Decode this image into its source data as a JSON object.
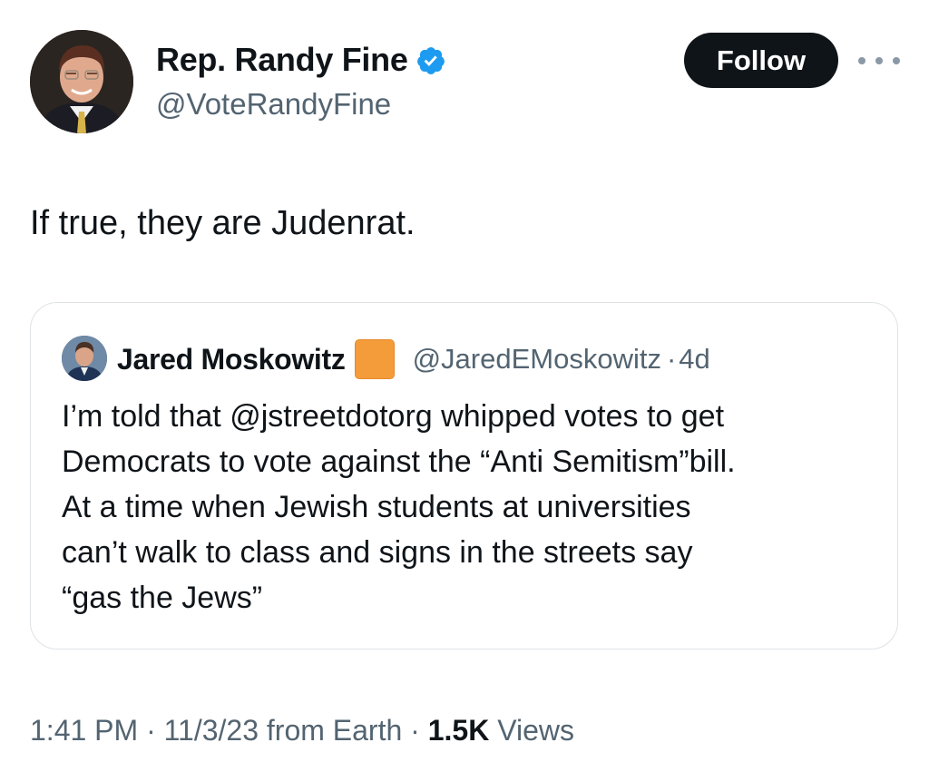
{
  "author": {
    "name": "Rep. Randy Fine",
    "handle": "@VoteRandyFine",
    "verified_icon": "verified-badge-icon",
    "verified_color": "#1d9bf0"
  },
  "follow_label": "Follow",
  "more_icon": "more-horizontal-icon",
  "tweet_text": "If true, they are Judenrat.",
  "quote": {
    "name": "Jared Moskowitz",
    "badge_icon": "orange-square-emoji",
    "badge_color": "#f49b3a",
    "handle": "@JaredEMoskowitz",
    "separator": "·",
    "time": "4d",
    "text": "I’m told that @jstreetdotorg whipped votes to get\nDemocrats to vote against the “Anti Semitism”bill.\nAt a time when Jewish students at universities\ncan’t walk to class and signs in the streets say\n“gas the Jews”"
  },
  "meta": {
    "time": "1:41 PM",
    "sep1": " · ",
    "date": "11/3/23",
    "source": " from Earth",
    "sep2": " · ",
    "views_count": "1.5K",
    "views_label": " Views"
  }
}
